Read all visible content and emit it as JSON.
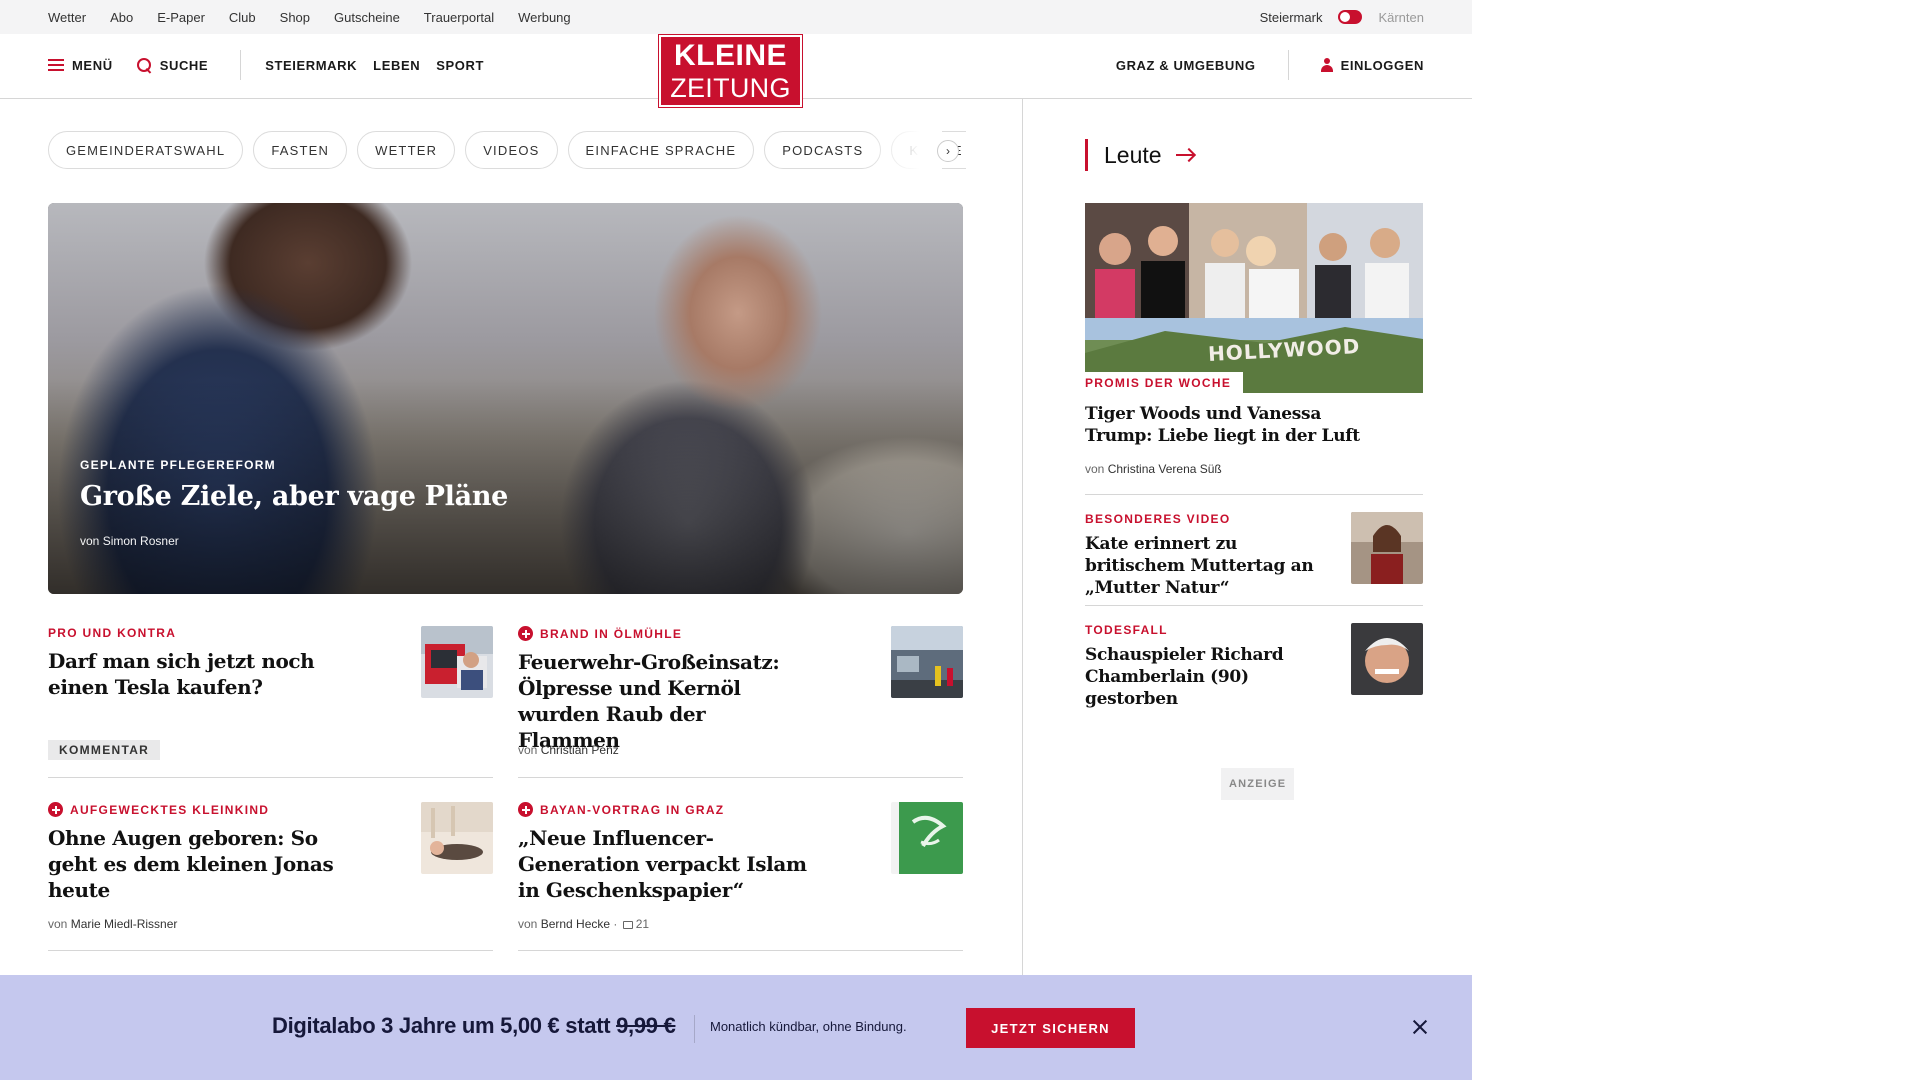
{
  "util": {
    "links": [
      "Wetter",
      "Abo",
      "E-Paper",
      "Club",
      "Shop",
      "Gutscheine",
      "Trauerportal",
      "Werbung"
    ],
    "region_active": "Steiermark",
    "region_inactive": "Kärnten"
  },
  "header": {
    "menu_label": "MENÜ",
    "search_label": "SUCHE",
    "sections": [
      "STEIERMARK",
      "LEBEN",
      "SPORT"
    ],
    "logo_line1": "KLEINE",
    "logo_line2": "ZEITUNG",
    "local_label": "GRAZ & UMGEBUNG",
    "login_label": "EINLOGGEN"
  },
  "chips": [
    "GEMEINDERATSWAHL",
    "FASTEN",
    "WETTER",
    "VIDEOS",
    "EINFACHE SPRACHE",
    "PODCASTS",
    "KLEINE KINDER"
  ],
  "hero": {
    "kicker": "GEPLANTE PFLEGEREFORM",
    "title": "Große Ziele, aber vage Pläne",
    "author_prefix": "von",
    "author": "Simon Rosner"
  },
  "articles": [
    {
      "kicker": "PRO UND KONTRA",
      "title": "Darf man sich jetzt noch einen Tesla kaufen?",
      "badge": "KOMMENTAR",
      "plus": false
    },
    {
      "kicker": "BRAND IN ÖLMÜHLE",
      "title": "Feuerwehr-Großeinsatz: Ölpresse und Kernöl wurden Raub der Flammen",
      "author": "Christian Penz",
      "plus": true
    },
    {
      "kicker": "AUFGEWECKTES KLEINKIND",
      "title": "Ohne Augen geboren: So geht es dem kleinen Jonas heute",
      "author": "Marie Miedl-Rissner",
      "plus": true
    },
    {
      "kicker": "BAYAN-VORTRAG IN GRAZ",
      "title": "„Neue Influencer-Generation verpackt Islam in Geschenkspapier“",
      "author": "Bernd Hecke",
      "comments": "21",
      "plus": true
    }
  ],
  "author_prefix": "von",
  "sidebar": {
    "heading": "Leute",
    "feature": {
      "image_text": "HOLLYWOOD",
      "kicker": "PROMIS DER WOCHE",
      "title": "Tiger Woods und Vanessa Trump: Liebe liegt in der Luft",
      "author": "Christina Verena Süß"
    },
    "items": [
      {
        "kicker": "BESONDERES VIDEO",
        "title": "Kate erinnert zu britischem Muttertag an „Mutter Natur“"
      },
      {
        "kicker": "TODESFALL",
        "title": "Schauspieler Richard Chamberlain (90) gestorben"
      }
    ],
    "ad_label": "ANZEIGE"
  },
  "promo": {
    "text": "Digitalabo 3 Jahre um 5,00 € statt",
    "old_price": "9,99 €",
    "sub": "Monatlich kündbar, ohne Bindung.",
    "button": "JETZT SICHERN"
  },
  "colors": {
    "brand_red": "#c8102e",
    "promo_bg": "#c5c8ee",
    "promo_text": "#16183a"
  }
}
